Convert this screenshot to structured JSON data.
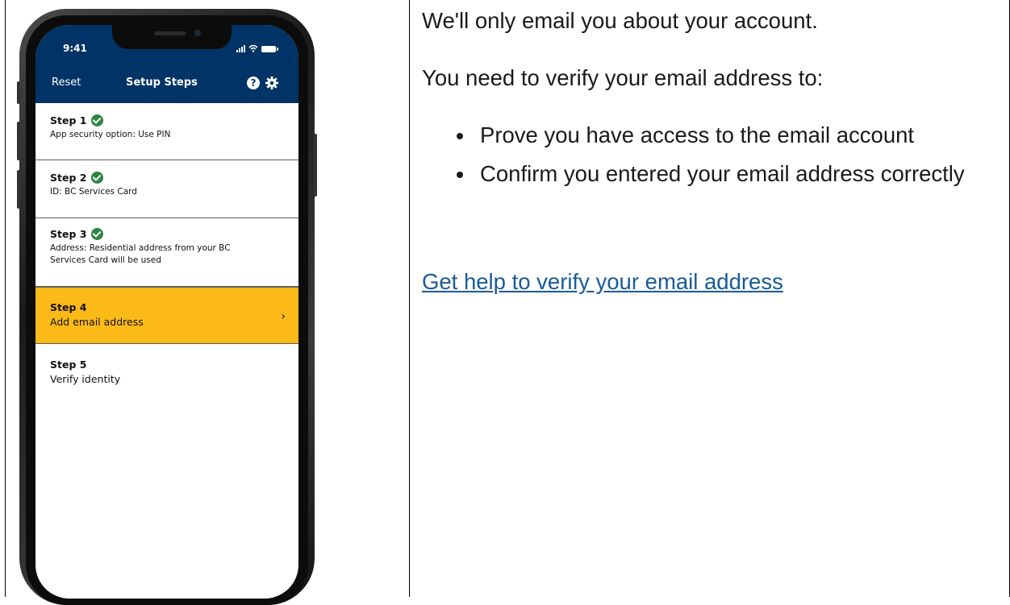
{
  "phone": {
    "status_time": "9:41",
    "header": {
      "reset_label": "Reset",
      "title": "Setup Steps",
      "help_icon": "?",
      "settings_icon": "gear-icon"
    },
    "steps": [
      {
        "title": "Step 1",
        "subtitle": "App security option: Use PIN",
        "completed": true
      },
      {
        "title": "Step 2",
        "subtitle": "ID: BC Services Card",
        "completed": true
      },
      {
        "title": "Step 3",
        "subtitle": "Address: Residential address from your BC Services Card will be used",
        "completed": true
      },
      {
        "title": "Step 4",
        "subtitle": "Add email address",
        "active": true,
        "chevron": "›"
      },
      {
        "title": "Step 5",
        "subtitle": "Verify identity"
      }
    ],
    "colors": {
      "header": "#003366",
      "active_step": "#fcba19",
      "check": "#2e8540"
    }
  },
  "content": {
    "paragraph1": "We'll only email you about your account.",
    "paragraph2": "You need to verify your email address to:",
    "bullets": [
      "Prove you have access to the email account",
      "Confirm you entered your email address correctly"
    ],
    "help_link": "Get help to verify your email address",
    "link_color": "#1a5a96"
  }
}
